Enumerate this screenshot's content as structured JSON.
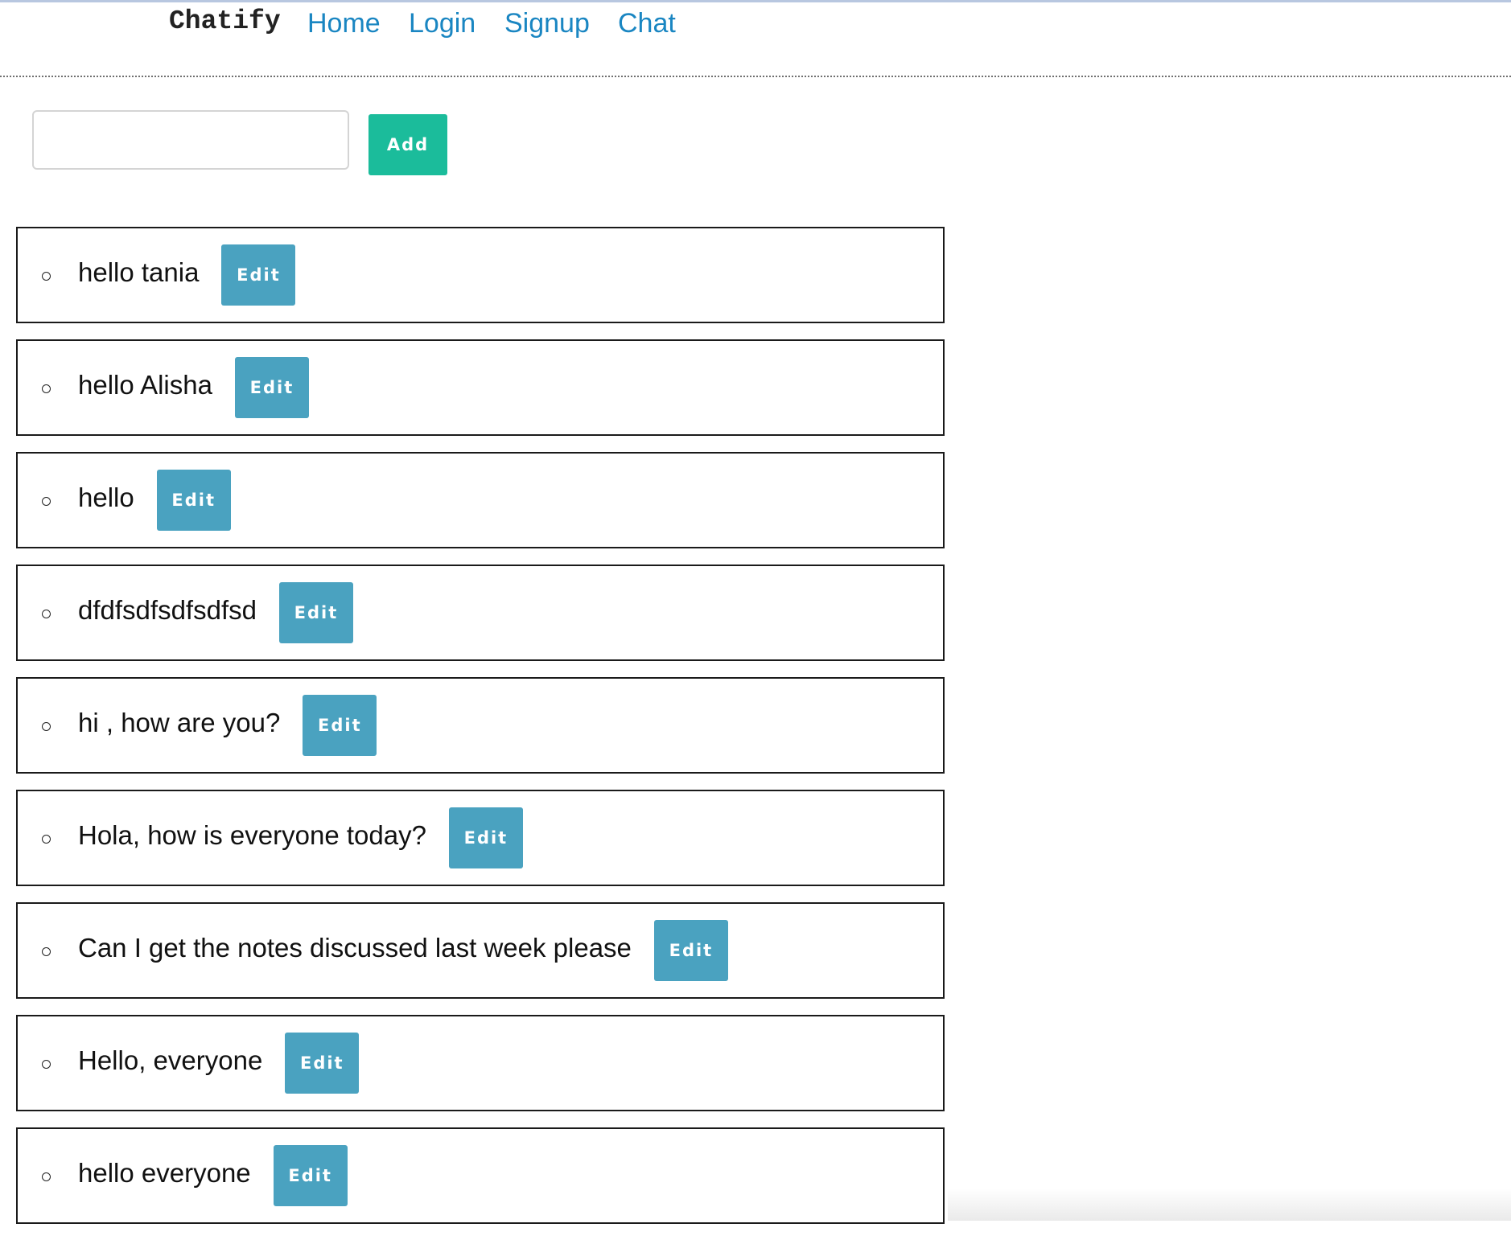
{
  "nav": {
    "brand": "Chatify",
    "links": [
      {
        "label": "Home"
      },
      {
        "label": "Login"
      },
      {
        "label": "Signup"
      },
      {
        "label": "Chat"
      }
    ]
  },
  "composer": {
    "input_value": "",
    "add_label": "Add"
  },
  "messages": [
    {
      "text": "hello tania",
      "edit_label": "Edit"
    },
    {
      "text": "hello Alisha",
      "edit_label": "Edit"
    },
    {
      "text": "hello",
      "edit_label": "Edit"
    },
    {
      "text": "dfdfsdfsdfsdfsd",
      "edit_label": "Edit"
    },
    {
      "text": "hi , how are you?",
      "edit_label": "Edit"
    },
    {
      "text": "Hola, how is everyone today?",
      "edit_label": "Edit"
    },
    {
      "text": "Can I get the notes discussed last week please",
      "edit_label": "Edit"
    },
    {
      "text": "Hello, everyone",
      "edit_label": "Edit"
    },
    {
      "text": "hello everyone",
      "edit_label": "Edit"
    }
  ],
  "colors": {
    "link": "#1a86c2",
    "add_button": "#1bbc9b",
    "edit_button": "#4aa2c0"
  }
}
